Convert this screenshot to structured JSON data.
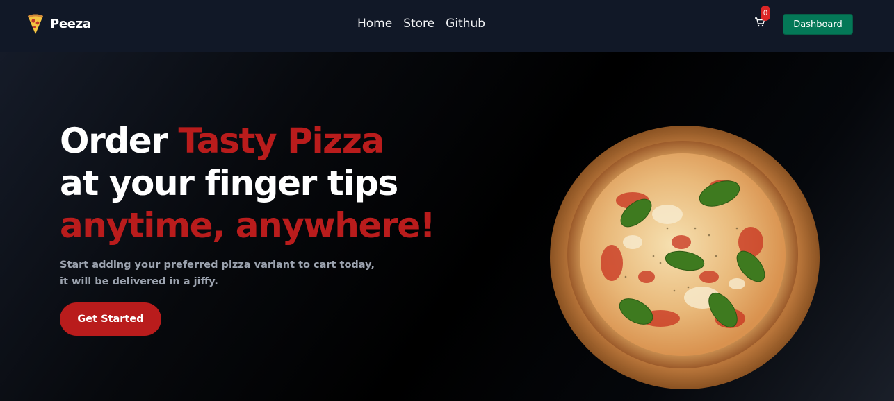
{
  "brand": {
    "name": "Peeza",
    "logo_icon": "pizza-slice-icon"
  },
  "nav": {
    "links": [
      "Home",
      "Store",
      "Github"
    ]
  },
  "cart": {
    "icon": "cart-icon",
    "count": "0"
  },
  "dashboard": {
    "label": "Dashboard"
  },
  "hero": {
    "headline": {
      "line1_plain": "Order ",
      "line1_accent": "Tasty Pizza",
      "line2": "at your finger tips",
      "line3": "anytime, anywhere!"
    },
    "subtext": {
      "line1": "Start adding your preferred pizza variant to cart today,",
      "line2": "it will be delivered in a jiffy."
    },
    "cta": "Get Started",
    "image": "margherita-pizza-image"
  },
  "colors": {
    "navbar": "#111827",
    "accent": "#b91c1c",
    "dashboard": "#047857",
    "badge": "#dc2626"
  }
}
